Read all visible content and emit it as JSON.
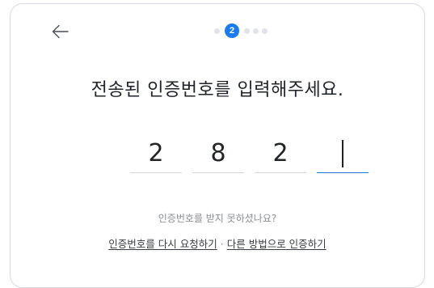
{
  "header": {
    "back_icon": "arrow-left-icon",
    "current_step": "2",
    "total_steps": 5
  },
  "main": {
    "title": "전송된 인증번호를 입력해주세요.",
    "code_digits": [
      "2",
      "8",
      "2",
      ""
    ],
    "hint": "인증번호를 받지 못하셨나요?",
    "resend_link": "인증번호를 다시 요청하기",
    "separator": "·",
    "other_method_link": "다른 방법으로 인증하기"
  },
  "colors": {
    "accent": "#1a7cf5",
    "text": "#1f2329",
    "muted": "#8b8f96"
  }
}
